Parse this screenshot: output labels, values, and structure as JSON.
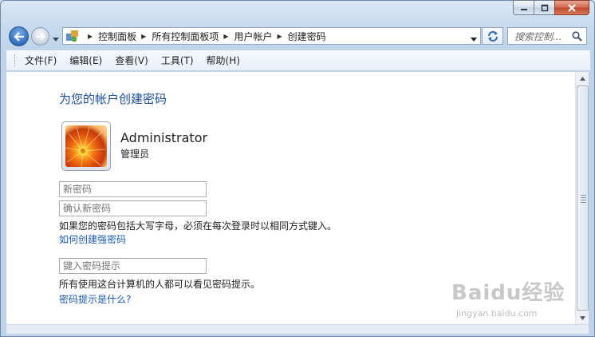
{
  "window": {
    "controls": [
      "minimize",
      "maximize",
      "close"
    ]
  },
  "address_bar": {
    "breadcrumbs": [
      "控制面板",
      "所有控制面板项",
      "用户帐户",
      "创建密码"
    ]
  },
  "search": {
    "placeholder": "搜索控制..."
  },
  "menu": {
    "items": [
      "文件(F)",
      "编辑(E)",
      "查看(V)",
      "工具(T)",
      "帮助(H)"
    ]
  },
  "page": {
    "title": "为您的帐户创建密码",
    "user": {
      "name": "Administrator",
      "role": "管理员"
    },
    "new_password_placeholder": "新密码",
    "confirm_password_placeholder": "确认新密码",
    "case_note": "如果您的密码包括大写字母，必须在每次登录时以相同方式键入。",
    "strong_password_link": "如何创建强密码",
    "hint_placeholder": "键入密码提示",
    "hint_note": "所有使用这台计算机的人都可以看见密码提示。",
    "hint_link": "密码提示是什么?"
  },
  "watermark": {
    "logo": "Baidu经验",
    "url": "jingyan.baidu.com"
  },
  "colors": {
    "link": "#1b5bb4",
    "title": "#1b4d9b",
    "accent": "#2f6bb8"
  }
}
